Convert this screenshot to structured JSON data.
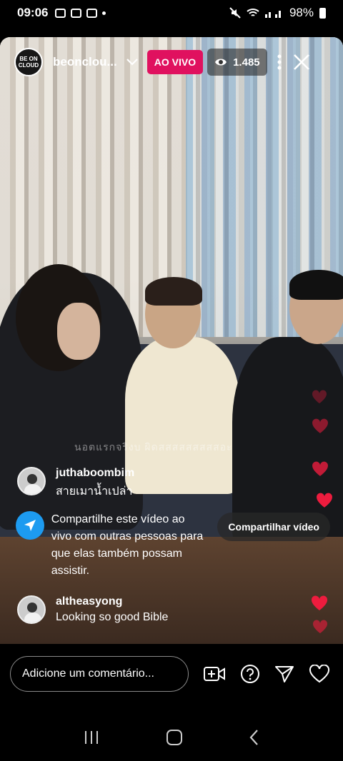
{
  "status_bar": {
    "time": "09:06",
    "battery": "98%"
  },
  "stream": {
    "logo_text": "BE ON CLOUD",
    "username": "beonclou...",
    "live_label": "AO VIVO",
    "viewer_count": "1.485",
    "overlay_caption": "นอตแรกจริงบ ผิดสสสสสสสสสอะ"
  },
  "comments": [
    {
      "user": "juthaboombim",
      "text": "สายเมาน้ำเปล่า"
    },
    {
      "user": "altheasyong",
      "text": "Looking so good Bible"
    }
  ],
  "share_prompt": {
    "text": "Compartilhe este vídeo ao vivo com outras pessoas para que elas também possam assistir.",
    "button_label": "Compartilhar vídeo"
  },
  "composer": {
    "placeholder": "Adicione um comentário..."
  },
  "icons": {
    "heart_color": "#ed1c3e",
    "live_color": "#e0115f",
    "share_color": "#1d9bf0"
  }
}
